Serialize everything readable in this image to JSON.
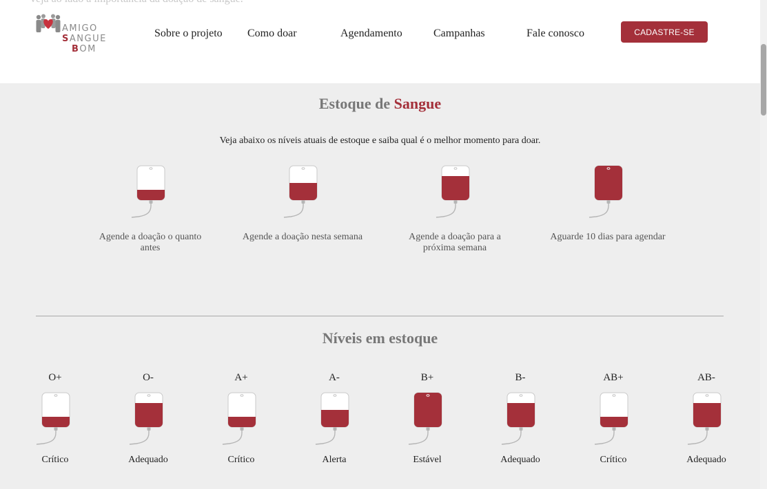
{
  "header": {
    "ghost_text": "veja ao lado a importância da doação de sangue.",
    "logo": {
      "line1": "AMIGO",
      "line2": "SANGUE",
      "line3": "BOM",
      "icon": "people-heart-icon"
    },
    "nav": [
      "Sobre o projeto",
      "Como doar",
      "Agendamento",
      "Campanhas",
      "Fale conosco"
    ],
    "cta_label": "CADASTRE-SE"
  },
  "stock_section": {
    "title_part1": "Estoque de",
    "title_part2": "Sangue",
    "subtitle": "Veja abaixo os níveis atuais de estoque e saiba qual é o melhor momento para doar.",
    "levels": [
      {
        "fill": 0.3,
        "label": "Agende a doação o quanto antes"
      },
      {
        "fill": 0.5,
        "label": "Agende a doação nesta semana"
      },
      {
        "fill": 0.7,
        "label": "Agende a doação para a próxima semana"
      },
      {
        "fill": 1.0,
        "label": "Aguarde 10 dias para agendar"
      }
    ]
  },
  "levels_section": {
    "title": "Níveis em estoque",
    "items": [
      {
        "type": "O+",
        "status": "Crítico",
        "fill": 0.3
      },
      {
        "type": "O-",
        "status": "Adequado",
        "fill": 0.7
      },
      {
        "type": "A+",
        "status": "Crítico",
        "fill": 0.3
      },
      {
        "type": "A-",
        "status": "Alerta",
        "fill": 0.5
      },
      {
        "type": "B+",
        "status": "Estável",
        "fill": 1.0
      },
      {
        "type": "B-",
        "status": "Adequado",
        "fill": 0.7
      },
      {
        "type": "AB+",
        "status": "Crítico",
        "fill": 0.3
      },
      {
        "type": "AB-",
        "status": "Adequado",
        "fill": 0.7
      }
    ]
  },
  "colors": {
    "accent": "#a4303a",
    "background": "#eeeeee",
    "header_bg": "#ffffff"
  }
}
